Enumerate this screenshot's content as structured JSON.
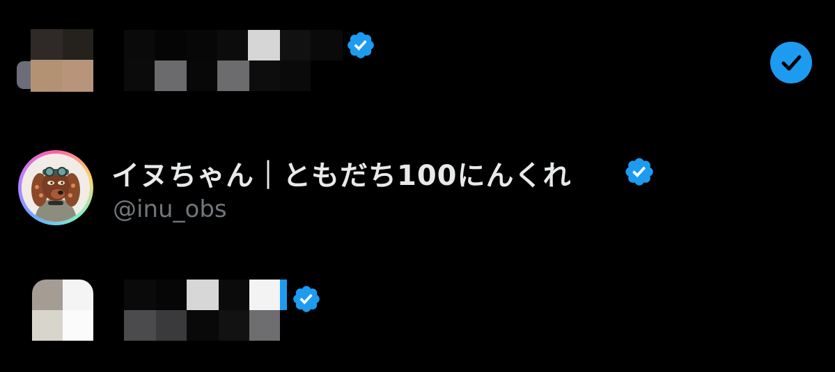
{
  "accounts": [
    {
      "redacted": true,
      "verified": true
    },
    {
      "redacted": false,
      "display_name": "イヌちゃん｜ともだち100にんくれ",
      "handle": "@inu_obs",
      "verified": true,
      "avatar_icon": "dog-cartoon-avatar"
    },
    {
      "redacted": true,
      "verified": true
    }
  ],
  "selected_account_index": 0,
  "colors": {
    "background": "#000000",
    "name_text": "#e7e9ea",
    "handle_text": "#71767b",
    "accent_blue": "#1d9bf0"
  }
}
